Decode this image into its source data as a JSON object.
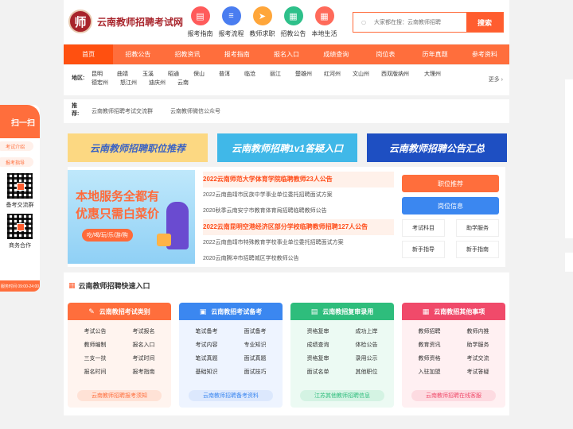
{
  "site": {
    "logo_glyph": "师",
    "name": "云南教师招聘考试网"
  },
  "quicknav": [
    {
      "label": "报考指南",
      "icon": "book-icon",
      "color": "#ff5b5b",
      "glyph": "▤"
    },
    {
      "label": "报考流程",
      "icon": "flow-icon",
      "color": "#4a7df0",
      "glyph": "≡"
    },
    {
      "label": "教师求职",
      "icon": "paper-plane-icon",
      "color": "#ffa63a",
      "glyph": "➤"
    },
    {
      "label": "招教公告",
      "icon": "notice-icon",
      "color": "#2ec08a",
      "glyph": "▦"
    },
    {
      "label": "本地生活",
      "icon": "grid-icon",
      "color": "#ff6a5a",
      "glyph": "▦"
    }
  ],
  "search": {
    "placeholder": "大家都在搜：云南教师招聘",
    "button": "搜索"
  },
  "nav": [
    "首页",
    "招教公告",
    "招教资讯",
    "报考指南",
    "报名入口",
    "成绩查询",
    "岗位表",
    "历年真题",
    "参考资料"
  ],
  "regions": {
    "label": "地区:",
    "items": [
      "昆明",
      "曲靖",
      "玉溪",
      "昭通",
      "保山",
      "普洱",
      "临沧",
      "丽江",
      "楚雄州",
      "红河州",
      "文山州",
      "西双版纳州",
      "大理州",
      "德宏州",
      "怒江州",
      "迪庆州",
      "云南"
    ],
    "more": "更多 ›"
  },
  "recommend": {
    "label": "推荐:",
    "links": [
      "云南教师招聘考试交流群",
      "云南教师微信公众号"
    ]
  },
  "banners": [
    "云南教师招聘职位推荐",
    "云南教师招聘1v1答疑入口",
    "云南教师招聘公告汇总"
  ],
  "ad": {
    "line1": "本地服务全都有",
    "line2": "优惠只需白菜价",
    "tag": "吃/喝/玩/乐/游/购"
  },
  "news": [
    {
      "text": "2022云南师范大学体育学院临聘教师23人公告",
      "hot": true
    },
    {
      "text": "2022云南曲靖市民族中学事业单位委托招聘面试方案",
      "hot": false
    },
    {
      "text": "2020秋季云南安宁市教育体育局招聘临聘教师公告",
      "hot": false
    },
    {
      "text": "2022云南昆明空港经济区部分学校临聘教师招聘127人公告",
      "hot": true
    },
    {
      "text": "2022云南曲靖市特殊教育学校事业单位委托招聘面试方案",
      "hot": false
    },
    {
      "text": "2020云南腾冲市招聘城区学校教师公告",
      "hot": false
    }
  ],
  "side": {
    "btn1": "职位推荐",
    "btn2": "岗位信息",
    "cells": [
      "考试科目",
      "助学服务",
      "新手指导",
      "新手指南"
    ]
  },
  "quick": {
    "title": "云南教师招聘快速入口",
    "cards": [
      {
        "title": "云南教招考试类别",
        "items": [
          "考试公告",
          "考试报名",
          "教师编制",
          "报名入口",
          "三支一扶",
          "考试时间",
          "报名时间",
          "报考指南"
        ],
        "foot": "云南教师招聘报考须知"
      },
      {
        "title": "云南教招考试备考",
        "items": [
          "笔试备考",
          "面试备考",
          "考试内容",
          "专业知识",
          "笔试真题",
          "面试真题",
          "基础知识",
          "面试技巧"
        ],
        "foot": "云南教师招聘备考资料"
      },
      {
        "title": "云南教招复审录用",
        "items": [
          "资格复审",
          "成功上岸",
          "成绩查询",
          "体检公告",
          "资格复审",
          "录用公示",
          "面试名单",
          "其他职位"
        ],
        "foot": "江苏其他教师招聘信息"
      },
      {
        "title": "云南教招其他事项",
        "items": [
          "教师招聘",
          "教师内推",
          "教育资讯",
          "助学服务",
          "教师资格",
          "考试交流",
          "入驻加盟",
          "考试答疑"
        ],
        "foot": "云南教师招聘在线客服"
      }
    ]
  },
  "float_panel": {
    "head": "扫一扫",
    "tag1": "考试介绍",
    "tag2": "报考指导",
    "text1": "备考交流群",
    "text2": "商务合作",
    "foot": "服务时间 09:00-24:00"
  }
}
